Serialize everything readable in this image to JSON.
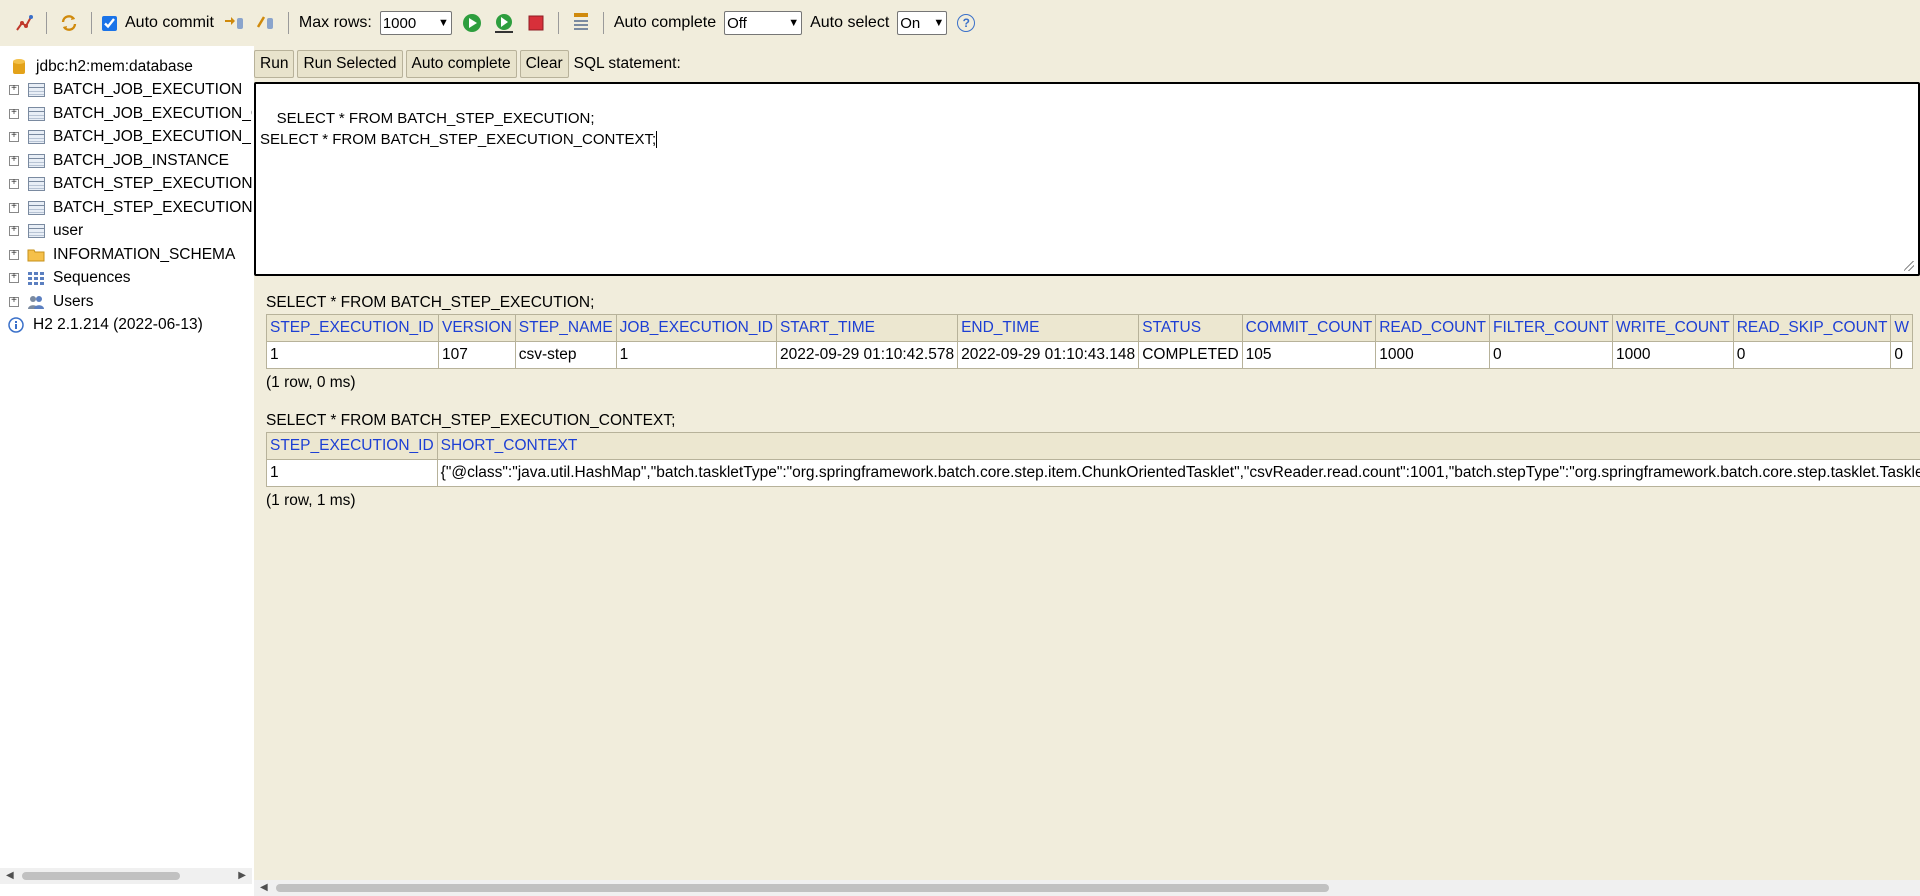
{
  "toolbar": {
    "auto_commit_label": "Auto commit",
    "auto_commit_checked": true,
    "max_rows_label": "Max rows:",
    "max_rows_value": "1000",
    "auto_complete_label": "Auto complete",
    "auto_complete_value": "Off",
    "auto_select_label": "Auto select",
    "auto_select_value": "On",
    "help_glyph": "?"
  },
  "sidebar": {
    "connection": "jdbc:h2:mem:database",
    "items": [
      {
        "label": "BATCH_JOB_EXECUTION",
        "icon": "table-icon"
      },
      {
        "label": "BATCH_JOB_EXECUTION_C",
        "icon": "table-icon"
      },
      {
        "label": "BATCH_JOB_EXECUTION_F",
        "icon": "table-icon"
      },
      {
        "label": "BATCH_JOB_INSTANCE",
        "icon": "table-icon"
      },
      {
        "label": "BATCH_STEP_EXECUTION",
        "icon": "table-icon"
      },
      {
        "label": "BATCH_STEP_EXECUTION_",
        "icon": "table-icon"
      },
      {
        "label": "user",
        "icon": "table-icon"
      },
      {
        "label": "INFORMATION_SCHEMA",
        "icon": "folder-icon"
      },
      {
        "label": "Sequences",
        "icon": "sequences-icon"
      },
      {
        "label": "Users",
        "icon": "users-icon"
      }
    ],
    "version": "H2 2.1.214 (2022-06-13)"
  },
  "query": {
    "run_label": "Run",
    "run_selected_label": "Run Selected",
    "auto_complete_label": "Auto complete",
    "clear_label": "Clear",
    "sql_label": "SQL statement:",
    "sql_text": "SELECT * FROM BATCH_STEP_EXECUTION;\nSELECT * FROM BATCH_STEP_EXECUTION_CONTEXT;"
  },
  "results": [
    {
      "statement": "SELECT * FROM BATCH_STEP_EXECUTION;",
      "columns": [
        "STEP_EXECUTION_ID",
        "VERSION",
        "STEP_NAME",
        "JOB_EXECUTION_ID",
        "START_TIME",
        "END_TIME",
        "STATUS",
        "COMMIT_COUNT",
        "READ_COUNT",
        "FILTER_COUNT",
        "WRITE_COUNT",
        "READ_SKIP_COUNT",
        "W"
      ],
      "rows": [
        [
          "1",
          "107",
          "csv-step",
          "1",
          "2022-09-29 01:10:42.578",
          "2022-09-29 01:10:43.148",
          "COMPLETED",
          "105",
          "1000",
          "0",
          "1000",
          "0",
          "0"
        ]
      ],
      "summary": "(1 row, 0 ms)"
    },
    {
      "statement": "SELECT * FROM BATCH_STEP_EXECUTION_CONTEXT;",
      "columns": [
        "STEP_EXECUTION_ID",
        "SHORT_CONTEXT"
      ],
      "rows": [
        [
          "1",
          "{\"@class\":\"java.util.HashMap\",\"batch.taskletType\":\"org.springframework.batch.core.step.item.ChunkOrientedTasklet\",\"csvReader.read.count\":1001,\"batch.stepType\":\"org.springframework.batch.core.step.tasklet.TaskletStep\""
        ]
      ],
      "summary": "(1 row, 1 ms)"
    }
  ]
}
